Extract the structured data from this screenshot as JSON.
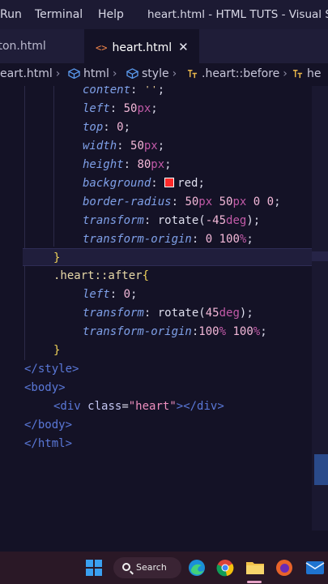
{
  "menu": {
    "run": "Run",
    "terminal": "Terminal",
    "help": "Help"
  },
  "window_title": "heart.html - HTML TUTS - Visual Stu",
  "tabs": [
    {
      "label": "tton.html",
      "active": false
    },
    {
      "label": "heart.html",
      "active": true,
      "close": "✕"
    }
  ],
  "breadcrumb": [
    {
      "label": "eart.html"
    },
    {
      "label": "html"
    },
    {
      "label": "style"
    },
    {
      "label": ".heart::before"
    },
    {
      "label": "he"
    }
  ],
  "code": {
    "l1": {
      "prop": "content",
      "value": "''"
    },
    "l2": {
      "prop": "left",
      "num": "50",
      "unit": "px"
    },
    "l3": {
      "prop": "top",
      "num": "0"
    },
    "l4": {
      "prop": "width",
      "num": "50",
      "unit": "px"
    },
    "l5": {
      "prop": "height",
      "num": "80",
      "unit": "px"
    },
    "l6": {
      "prop": "background",
      "value": "red",
      "swatch_color": "#ff0000"
    },
    "l7": {
      "prop": "border-radius",
      "n1": "50",
      "u1": "px",
      "n2": "50",
      "u2": "px",
      "n3": "0",
      "n4": "0"
    },
    "l8": {
      "prop": "transform",
      "fn": "rotate(",
      "num": "-45",
      "unit": "deg",
      "close": ")"
    },
    "l9": {
      "prop": "transform-origin",
      "n1": "0",
      "n2": "100",
      "unit": "%"
    },
    "l10": {
      "brace": "}"
    },
    "l11": {
      "selector": ".heart::after",
      "brace": "{"
    },
    "l12": {
      "prop": "left",
      "num": "0"
    },
    "l13": {
      "prop": "transform",
      "fn": "rotate(",
      "num": "45",
      "unit": "deg",
      "close": ")"
    },
    "l14": {
      "prop": "transform-origin",
      "n1": "100",
      "u1": "%",
      "n2": "100",
      "u2": "%"
    },
    "l15": {
      "brace": "}"
    },
    "l16": {
      "tag": "</style>"
    },
    "l17": {
      "tag": "<body>"
    },
    "l18": {
      "open": "<div",
      "attr": "class",
      "eq": "=",
      "val": "\"heart\"",
      "close": "></div>"
    },
    "l19": {
      "tag": "</body>"
    },
    "l20": {
      "tag": "</html>"
    }
  },
  "taskbar": {
    "search_label": "Search"
  },
  "colors": {
    "accent": "#2a4a8a",
    "editor_bg": "#141226"
  }
}
